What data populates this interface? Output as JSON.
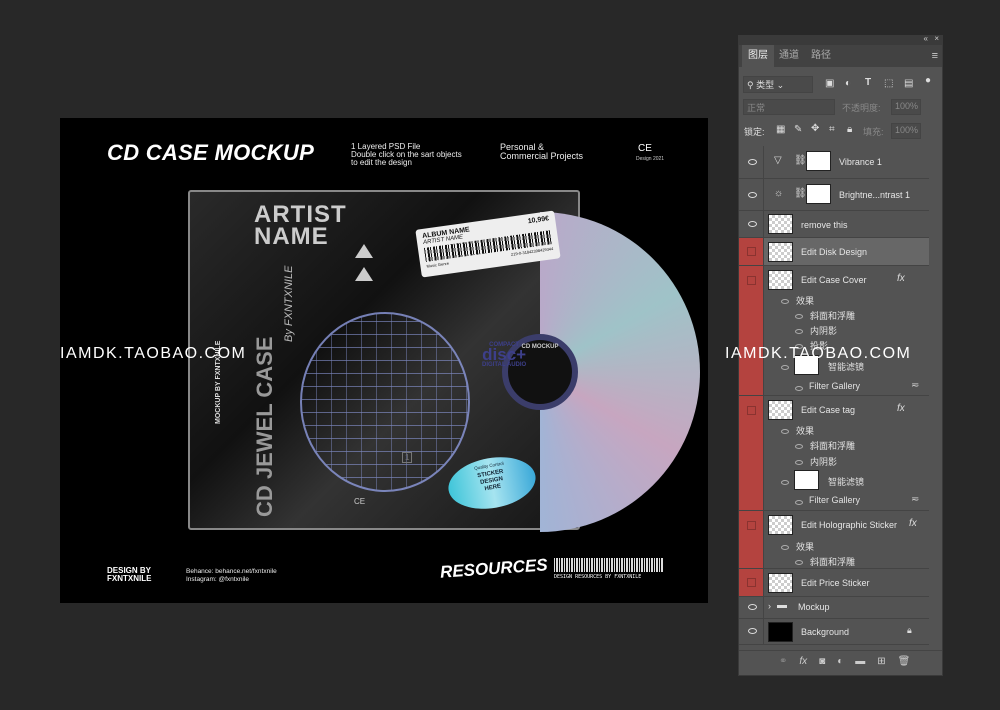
{
  "canvas": {
    "title": "CD CASE MOCKUP",
    "info_lines": [
      "1 Layered PSD File",
      "Double click on the sart objects",
      "to edit the design"
    ],
    "license_lines": [
      "Personal &",
      "Commercial Projects"
    ],
    "ce_mark": "CE",
    "design_year": "Design 2021",
    "footer": {
      "design_by": [
        "DESIGN BY",
        "FXNTXNILE"
      ],
      "behance": "Behance: behance.net/fxntxnile",
      "instagram": "Instagram: @fxntxnile",
      "resources_logo": "RESOURCES",
      "barcode_caption": "DESIGN RESOURCES BY FXNTXNILE"
    },
    "cover": {
      "artist": [
        "ARTIST",
        "NAME"
      ],
      "spine": "CD JEWEL CASE",
      "by": "By FXNTXNILE",
      "side": "MOCKUP BY FXNTXNILE",
      "hub_text": "CD MOCKUP",
      "disc_logo": [
        "COMPACT",
        "disc+",
        "DIGITAL AUDIO"
      ],
      "price_sticker": {
        "album": "ALBUM NAME",
        "price": "10,99€",
        "artist": "ARTIST NAME",
        "code": "219-0-31842398429344",
        "genre": "Music Genre"
      },
      "holo_sticker": [
        "STICKER",
        "DESIGN",
        "HERE"
      ],
      "quality": "Quality Control",
      "track": "1"
    }
  },
  "watermark": "IAMDK.TAOBAO.COM",
  "panel": {
    "tabs": [
      "图层",
      "通道",
      "路径"
    ],
    "filter_kind": "类型",
    "blend_mode": "正常",
    "opacity_label": "不透明度:",
    "opacity": "100%",
    "lock_label": "锁定:",
    "fill_label": "填充:",
    "fill": "100%",
    "layers": [
      {
        "name": "Vibrance 1",
        "visible": true
      },
      {
        "name": "Brightne...ntrast 1",
        "visible": true
      },
      {
        "name": "remove this",
        "visible": true
      },
      {
        "name": "Edit Disk Design",
        "selected": true
      },
      {
        "name": "Edit Case Cover",
        "effects": [
          "效果",
          "斜面和浮雕",
          "内阴影",
          "投影"
        ],
        "smart_filters": "智能滤镜",
        "filter": "Filter Gallery"
      },
      {
        "name": "Edit Case tag",
        "effects": [
          "效果",
          "斜面和浮雕",
          "内阴影"
        ],
        "smart_filters": "智能滤镜",
        "filter": "Filter Gallery"
      },
      {
        "name": "Edit Holographic Sticker",
        "effects": [
          "效果",
          "斜面和浮雕"
        ]
      },
      {
        "name": "Edit Price Sticker"
      },
      {
        "name": "Mockup",
        "visible": true,
        "type": "group"
      },
      {
        "name": "Background",
        "visible": true,
        "locked": true
      }
    ],
    "fx": "fx",
    "accent_red": "#b4433f"
  }
}
